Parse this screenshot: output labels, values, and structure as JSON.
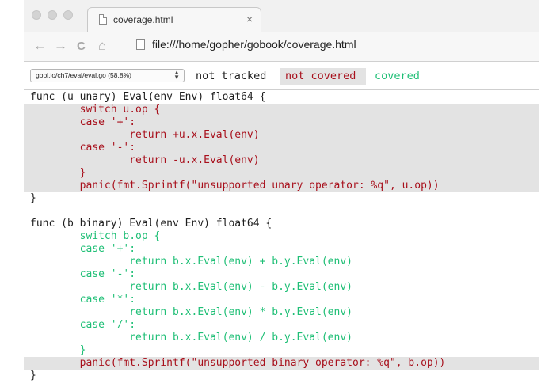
{
  "browser": {
    "tab_title": "coverage.html",
    "tab_close": "×",
    "address": "file:///home/gopher/gobook/coverage.html",
    "nav_back": "←",
    "nav_forward": "→",
    "nav_reload": "C",
    "nav_home": "⌂"
  },
  "controls": {
    "file_selected": "gopl.io/ch7/eval/eval.go (58.8%)",
    "legend_not_tracked": "not tracked",
    "legend_not_covered": "not covered",
    "legend_covered": "covered"
  },
  "colors": {
    "not_tracked": "#1e1e1e",
    "not_covered": "#a8101c",
    "covered": "#1fbf76",
    "highlight": "#e3e3e3"
  },
  "code_lines": [
    {
      "text": "func (u unary) Eval(env Env) float64 {",
      "class": "t-default"
    },
    {
      "text": "        switch u.op {",
      "class": "t-red"
    },
    {
      "text": "        case '+':",
      "class": "t-red"
    },
    {
      "text": "                return +u.x.Eval(env)",
      "class": "t-red"
    },
    {
      "text": "        case '-':",
      "class": "t-red"
    },
    {
      "text": "                return -u.x.Eval(env)",
      "class": "t-red"
    },
    {
      "text": "        }",
      "class": "t-red"
    },
    {
      "text": "        panic(fmt.Sprintf(\"unsupported unary operator: %q\", u.op))",
      "class": "t-red"
    },
    {
      "text": "}",
      "class": "t-default"
    },
    {
      "text": "",
      "class": "t-default"
    },
    {
      "text": "func (b binary) Eval(env Env) float64 {",
      "class": "t-default"
    },
    {
      "text": "        switch b.op {",
      "class": "t-green"
    },
    {
      "text": "        case '+':",
      "class": "t-green"
    },
    {
      "text": "                return b.x.Eval(env) + b.y.Eval(env)",
      "class": "t-green"
    },
    {
      "text": "        case '-':",
      "class": "t-green"
    },
    {
      "text": "                return b.x.Eval(env) - b.y.Eval(env)",
      "class": "t-green"
    },
    {
      "text": "        case '*':",
      "class": "t-green"
    },
    {
      "text": "                return b.x.Eval(env) * b.y.Eval(env)",
      "class": "t-green"
    },
    {
      "text": "        case '/':",
      "class": "t-green"
    },
    {
      "text": "                return b.x.Eval(env) / b.y.Eval(env)",
      "class": "t-green"
    },
    {
      "text": "        }",
      "class": "t-green"
    },
    {
      "text": "        panic(fmt.Sprintf(\"unsupported binary operator: %q\", b.op))",
      "class": "t-red"
    },
    {
      "text": "}",
      "class": "t-default"
    }
  ]
}
